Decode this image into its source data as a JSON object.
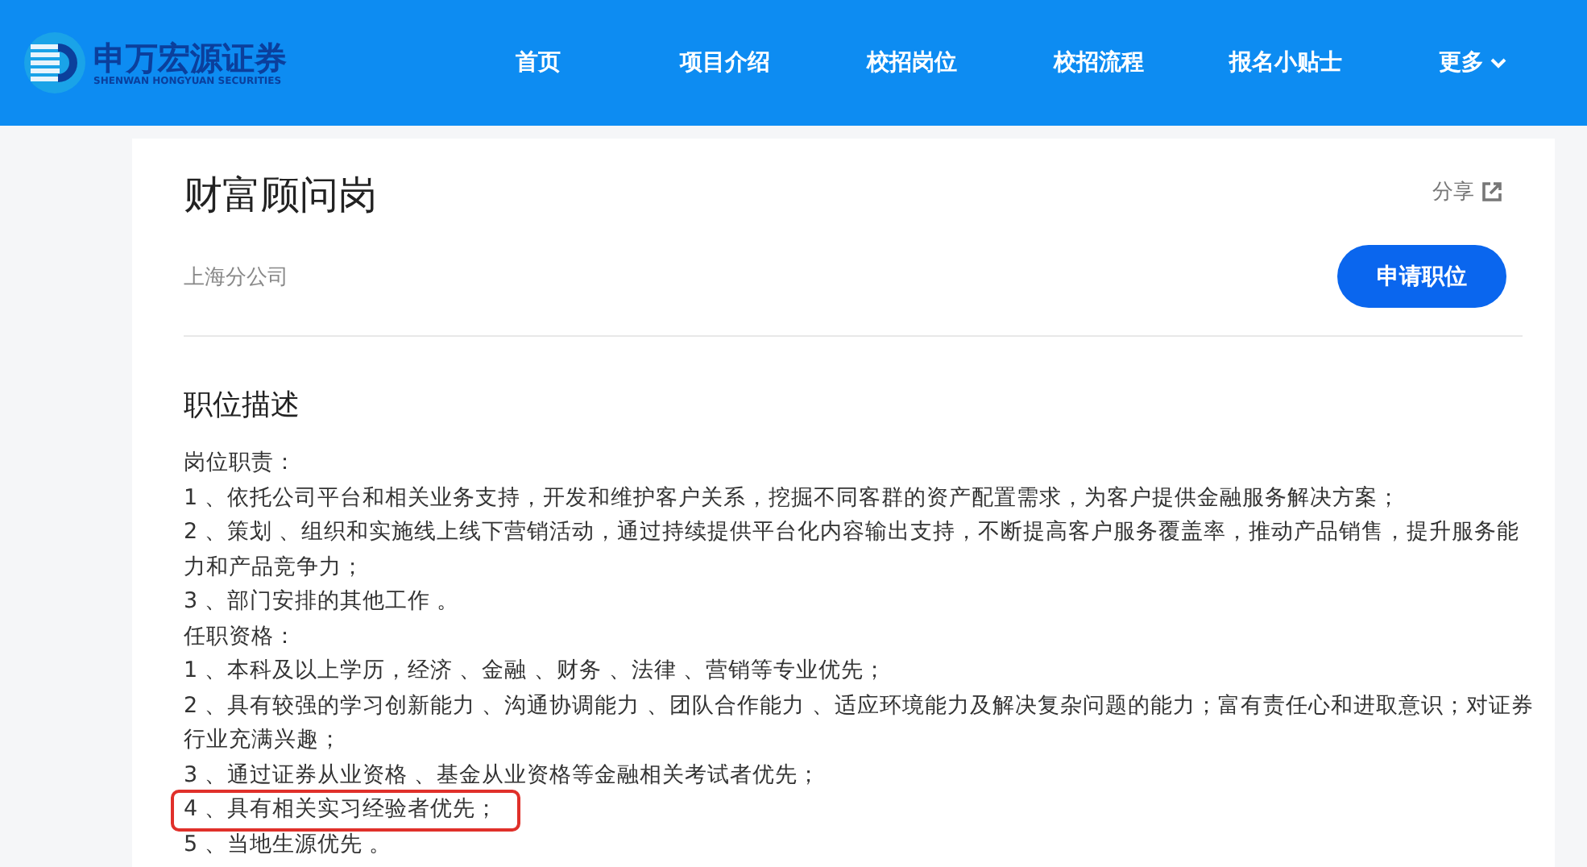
{
  "logo": {
    "name": "申万宏源证券",
    "subtitle": "SHENWAN HONGYUAN SECURITIES"
  },
  "nav": [
    {
      "label": "首页",
      "dropdown": false
    },
    {
      "label": "项目介绍",
      "dropdown": false
    },
    {
      "label": "校招岗位",
      "dropdown": false
    },
    {
      "label": "校招流程",
      "dropdown": false
    },
    {
      "label": "报名小贴士",
      "dropdown": false
    },
    {
      "label": "更多",
      "dropdown": true
    }
  ],
  "job": {
    "title": "财富顾问岗",
    "location": "上海分公司",
    "share": "分享",
    "apply": "申请职位"
  },
  "description": {
    "heading": "职位描述",
    "lines": [
      {
        "text": "岗位职责：",
        "highlighted": false
      },
      {
        "text": "1 、依托公司平台和相关业务支持，开发和维护客户关系，挖掘不同客群的资产配置需求，为客户提供金融服务解决方案；",
        "highlighted": false
      },
      {
        "text": "2 、策划 、组织和实施线上线下营销活动，通过持续提供平台化内容输出支持，不断提高客户服务覆盖率，推动产品销售，提升服务能力和产品竞争力；",
        "highlighted": false
      },
      {
        "text": "3 、部门安排的其他工作 。",
        "highlighted": false
      },
      {
        "text": "任职资格：",
        "highlighted": false
      },
      {
        "text": "1 、本科及以上学历，经济 、金融 、财务 、法律 、营销等专业优先；",
        "highlighted": false
      },
      {
        "text": "2 、具有较强的学习创新能力 、沟通协调能力 、团队合作能力 、适应环境能力及解决复杂问题的能力；富有责任心和进取意识；对证券行业充满兴趣；",
        "highlighted": false
      },
      {
        "text": "3 、通过证券从业资格 、基金从业资格等金融相关考试者优先；",
        "highlighted": false
      },
      {
        "text": "4 、具有相关实习经验者优先；",
        "highlighted": true
      },
      {
        "text": "5 、当地生源优先 。",
        "highlighted": false
      }
    ]
  }
}
